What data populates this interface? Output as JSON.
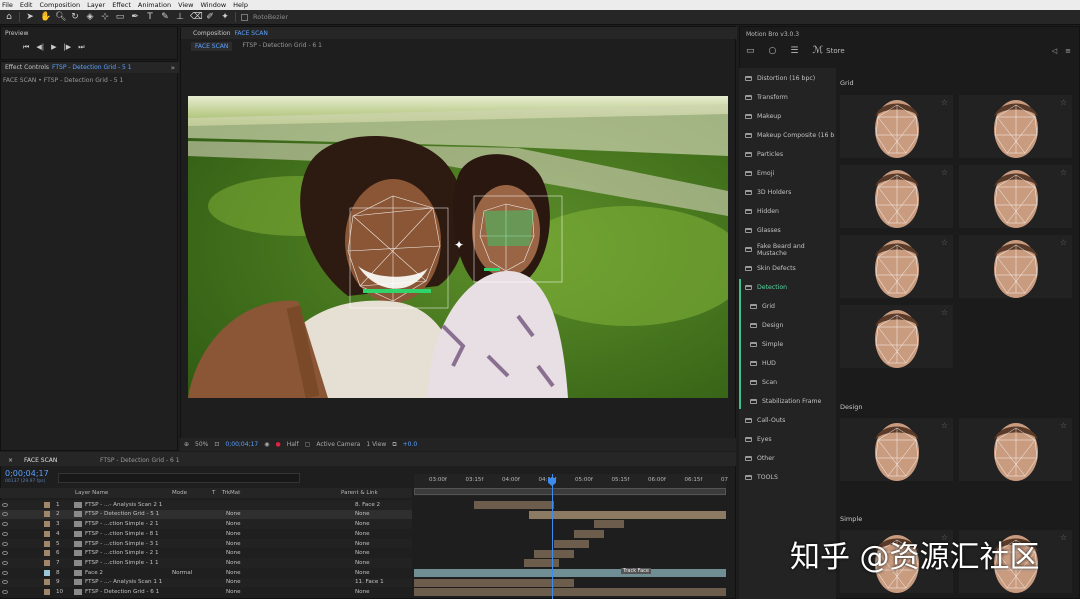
{
  "menu": [
    "File",
    "Edit",
    "Composition",
    "Layer",
    "Effect",
    "Animation",
    "View",
    "Window",
    "Help"
  ],
  "toolbar": {
    "rotobezier_label": "RotoBezier"
  },
  "preview": {
    "tab": "Preview"
  },
  "effect_controls": {
    "tab_prefix": "Effect Controls",
    "tab_layer": "FTSP - Detection Grid - 5 1",
    "breadcrumb": "FACE SCAN • FTSP - Detection Grid - 5 1"
  },
  "composition": {
    "tab_prefix": "Composition",
    "tab_name": "FACE SCAN",
    "subtab_active": "FACE SCAN",
    "subtab_other": "FTSP - Detection Grid - 6 1"
  },
  "viewer_bar": {
    "zoom": "50%",
    "timecode": "0;00;04;17",
    "resolution": "Half",
    "camera": "Active Camera",
    "view": "1 View",
    "exposure": "+0.0"
  },
  "motion_bro": {
    "title": "Motion Bro v3.0.3",
    "store_label": "Store",
    "categories": [
      {
        "label": "Distortion (16 bpc)",
        "sub": false,
        "active": false
      },
      {
        "label": "Transform",
        "sub": false,
        "active": false
      },
      {
        "label": "Makeup",
        "sub": false,
        "active": false
      },
      {
        "label": "Makeup Composite (16 b",
        "sub": false,
        "active": false
      },
      {
        "label": "Particles",
        "sub": false,
        "active": false
      },
      {
        "label": "Emoji",
        "sub": false,
        "active": false
      },
      {
        "label": "3D Holders",
        "sub": false,
        "active": false
      },
      {
        "label": "Hidden",
        "sub": false,
        "active": false
      },
      {
        "label": "Glasses",
        "sub": false,
        "active": false
      },
      {
        "label": "Fake Beard and Mustache",
        "sub": false,
        "active": false
      },
      {
        "label": "Skin Defects",
        "sub": false,
        "active": false
      },
      {
        "label": "Detection",
        "sub": false,
        "active": true
      },
      {
        "label": "Grid",
        "sub": true,
        "active": false
      },
      {
        "label": "Design",
        "sub": true,
        "active": false
      },
      {
        "label": "Simple",
        "sub": true,
        "active": false
      },
      {
        "label": "HUD",
        "sub": true,
        "active": false
      },
      {
        "label": "Scan",
        "sub": true,
        "active": false
      },
      {
        "label": "Stabilization Frame",
        "sub": true,
        "active": false
      },
      {
        "label": "Call-Outs",
        "sub": false,
        "active": false
      },
      {
        "label": "Eyes",
        "sub": false,
        "active": false
      },
      {
        "label": "Other",
        "sub": false,
        "active": false
      },
      {
        "label": "TOOLS",
        "sub": false,
        "active": false
      }
    ],
    "sections": [
      "Grid",
      "Design",
      "Simple"
    ]
  },
  "timeline": {
    "tab_active": "FACE SCAN",
    "tab_other": "FTSP - Detection Grid - 6 1",
    "timecode": "0;00;04;17",
    "fps_note": "00137 (29.97 fps)",
    "headers": {
      "layer_name": "Layer Name",
      "mode": "Mode",
      "t": "T",
      "trkmat": "TrkMat",
      "parent": "Parent & Link"
    },
    "ruler": [
      "03:00f",
      "03:15f",
      "04:00f",
      "04:15f",
      "05:00f",
      "05:15f",
      "06:00f",
      "06:15f",
      "07"
    ],
    "rows": [
      {
        "num": "1",
        "name": "FTSP - ...- Analysis Scan 2 1",
        "mode": "",
        "trk": "",
        "parent": "8. Face 2",
        "color": "#a0866a"
      },
      {
        "num": "2",
        "name": "FTSP - Detection Grid - 5 1",
        "mode": "",
        "trk": "None",
        "parent": "None",
        "color": "#a0866a"
      },
      {
        "num": "3",
        "name": "FTSP - ...ction Simple - 2 1",
        "mode": "",
        "trk": "None",
        "parent": "None",
        "color": "#a0866a"
      },
      {
        "num": "4",
        "name": "FTSP - ...ction Simple - 8 1",
        "mode": "",
        "trk": "None",
        "parent": "None",
        "color": "#a0866a"
      },
      {
        "num": "5",
        "name": "FTSP - ...ction Simple - 3 1",
        "mode": "",
        "trk": "None",
        "parent": "None",
        "color": "#a0866a"
      },
      {
        "num": "6",
        "name": "FTSP - ...ction Simple - 2 1",
        "mode": "",
        "trk": "None",
        "parent": "None",
        "color": "#a0866a"
      },
      {
        "num": "7",
        "name": "FTSP - ...ction Simple - 1 1",
        "mode": "",
        "trk": "None",
        "parent": "None",
        "color": "#a0866a"
      },
      {
        "num": "8",
        "name": "Face 2",
        "mode": "Normal",
        "trk": "None",
        "parent": "None",
        "color": "#9cc7d8"
      },
      {
        "num": "9",
        "name": "FTSP - ...- Analysis Scan 1 1",
        "mode": "",
        "trk": "None",
        "parent": "11. Face 1",
        "color": "#a0866a"
      },
      {
        "num": "10",
        "name": "FTSP - Detection Grid - 6 1",
        "mode": "",
        "trk": "None",
        "parent": "None",
        "color": "#a0866a"
      }
    ],
    "track_label": "Track Face"
  },
  "watermark": "知乎 @资源汇社区"
}
